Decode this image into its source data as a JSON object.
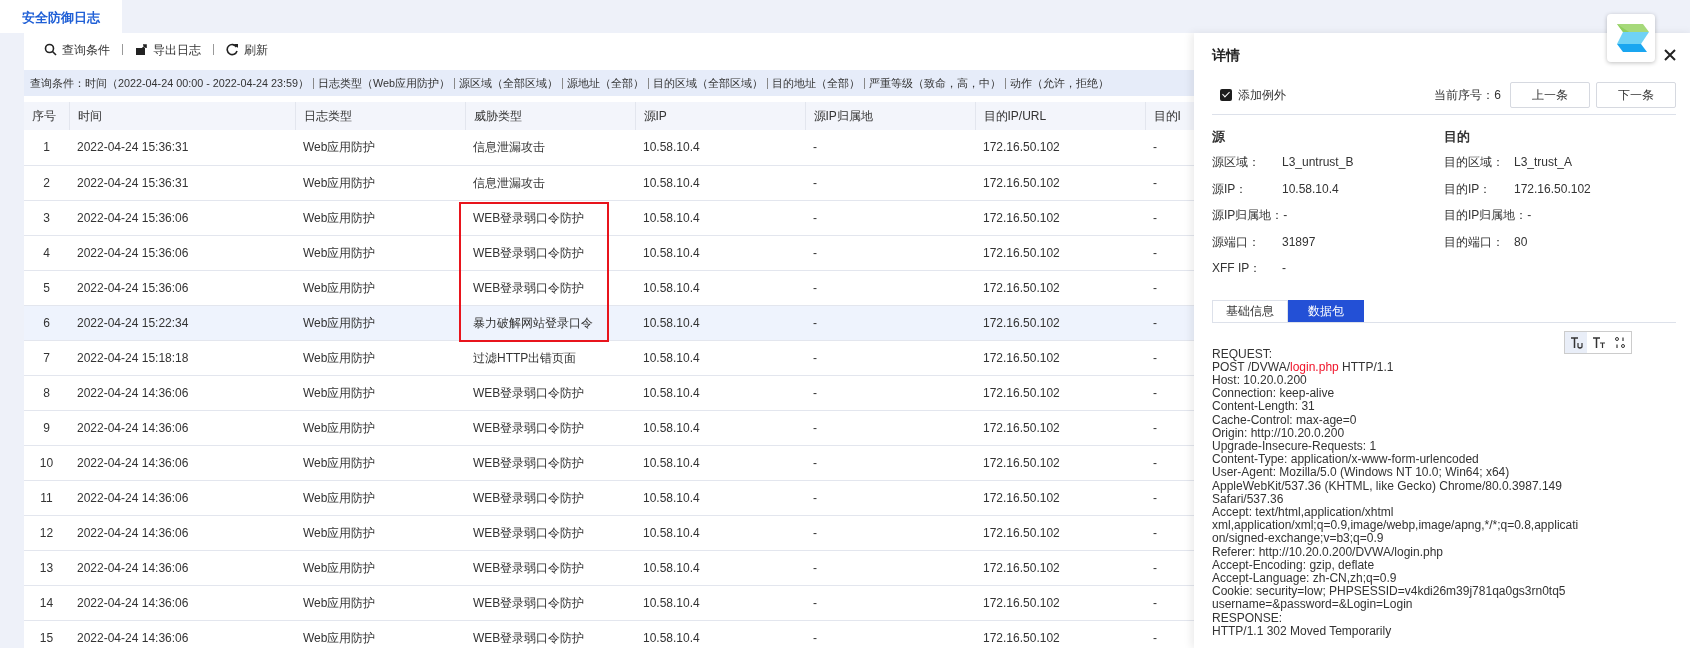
{
  "page_tab": {
    "label": "安全防御日志",
    "selected": true
  },
  "toolbar": [
    {
      "kind": "search",
      "label": "查询条件"
    },
    {
      "kind": "export",
      "label": "导出日志"
    },
    {
      "kind": "refresh",
      "label": "刷新"
    }
  ],
  "filter": {
    "label": "查询条件：",
    "items": [
      "时间（2022-04-24 00:00 - 2022-04-24 23:59）",
      "日志类型（Web应用防护）",
      "源区域（全部区域）",
      "源地址（全部）",
      "目的区域（全部区域）",
      "目的地址（全部）",
      "严重等级（致命，高，中）",
      "动作（允许，拒绝）"
    ]
  },
  "table": {
    "columns": [
      "序号",
      "时间",
      "日志类型",
      "威胁类型",
      "源IP",
      "源IP归属地",
      "目的IP/URL",
      "目的I"
    ],
    "rows": [
      {
        "cells": [
          "1",
          "2022-04-24 15:36:31",
          "Web应用防护",
          "信息泄漏攻击",
          "10.58.10.4",
          "-",
          "172.16.50.102",
          "-"
        ],
        "selected": false,
        "flagged": false
      },
      {
        "cells": [
          "2",
          "2022-04-24 15:36:31",
          "Web应用防护",
          "信息泄漏攻击",
          "10.58.10.4",
          "-",
          "172.16.50.102",
          "-"
        ],
        "selected": false,
        "flagged": false
      },
      {
        "cells": [
          "3",
          "2022-04-24 15:36:06",
          "Web应用防护",
          "WEB登录弱口令防护",
          "10.58.10.4",
          "-",
          "172.16.50.102",
          "-"
        ],
        "selected": false,
        "flagged": true
      },
      {
        "cells": [
          "4",
          "2022-04-24 15:36:06",
          "Web应用防护",
          "WEB登录弱口令防护",
          "10.58.10.4",
          "-",
          "172.16.50.102",
          "-"
        ],
        "selected": false,
        "flagged": true
      },
      {
        "cells": [
          "5",
          "2022-04-24 15:36:06",
          "Web应用防护",
          "WEB登录弱口令防护",
          "10.58.10.4",
          "-",
          "172.16.50.102",
          "-"
        ],
        "selected": false,
        "flagged": true
      },
      {
        "cells": [
          "6",
          "2022-04-24 15:22:34",
          "Web应用防护",
          "暴力破解网站登录口令",
          "10.58.10.4",
          "-",
          "172.16.50.102",
          "-"
        ],
        "selected": true,
        "flagged": true
      },
      {
        "cells": [
          "7",
          "2022-04-24 15:18:18",
          "Web应用防护",
          "过滤HTTP出错页面",
          "10.58.10.4",
          "-",
          "172.16.50.102",
          "-"
        ],
        "selected": false,
        "flagged": false
      },
      {
        "cells": [
          "8",
          "2022-04-24 14:36:06",
          "Web应用防护",
          "WEB登录弱口令防护",
          "10.58.10.4",
          "-",
          "172.16.50.102",
          "-"
        ],
        "selected": false,
        "flagged": false
      },
      {
        "cells": [
          "9",
          "2022-04-24 14:36:06",
          "Web应用防护",
          "WEB登录弱口令防护",
          "10.58.10.4",
          "-",
          "172.16.50.102",
          "-"
        ],
        "selected": false,
        "flagged": false
      },
      {
        "cells": [
          "10",
          "2022-04-24 14:36:06",
          "Web应用防护",
          "WEB登录弱口令防护",
          "10.58.10.4",
          "-",
          "172.16.50.102",
          "-"
        ],
        "selected": false,
        "flagged": false
      },
      {
        "cells": [
          "11",
          "2022-04-24 14:36:06",
          "Web应用防护",
          "WEB登录弱口令防护",
          "10.58.10.4",
          "-",
          "172.16.50.102",
          "-"
        ],
        "selected": false,
        "flagged": false
      },
      {
        "cells": [
          "12",
          "2022-04-24 14:36:06",
          "Web应用防护",
          "WEB登录弱口令防护",
          "10.58.10.4",
          "-",
          "172.16.50.102",
          "-"
        ],
        "selected": false,
        "flagged": false
      },
      {
        "cells": [
          "13",
          "2022-04-24 14:36:06",
          "Web应用防护",
          "WEB登录弱口令防护",
          "10.58.10.4",
          "-",
          "172.16.50.102",
          "-"
        ],
        "selected": false,
        "flagged": false
      },
      {
        "cells": [
          "14",
          "2022-04-24 14:36:06",
          "Web应用防护",
          "WEB登录弱口令防护",
          "10.58.10.4",
          "-",
          "172.16.50.102",
          "-"
        ],
        "selected": false,
        "flagged": false
      },
      {
        "cells": [
          "15",
          "2022-04-24 14:36:06",
          "Web应用防护",
          "WEB登录弱口令防护",
          "10.58.10.4",
          "-",
          "172.16.50.102",
          "-"
        ],
        "selected": false,
        "flagged": false
      }
    ]
  },
  "detail": {
    "title": "详情",
    "add_exception": {
      "label": "添加例外",
      "checked": true
    },
    "current": "当前序号：6",
    "buttons": [
      "上一条",
      "下一条"
    ],
    "source": {
      "heading": "源",
      "fields": [
        {
          "label": "源区域：",
          "value": "L3_untrust_B"
        },
        {
          "label": "源IP：",
          "value": "10.58.10.4"
        },
        {
          "label": "源IP归属地：",
          "value": "-"
        },
        {
          "label": "源端口：",
          "value": "31897"
        },
        {
          "label": "XFF IP：",
          "value": "-"
        }
      ]
    },
    "destination": {
      "heading": "目的",
      "fields": [
        {
          "label": "目的区域：",
          "value": "L3_trust_A"
        },
        {
          "label": "目的IP：",
          "value": "172.16.50.102"
        },
        {
          "label": "目的IP归属地：",
          "value": "-"
        },
        {
          "label": "目的端口：",
          "value": "80"
        }
      ]
    },
    "tabs": [
      {
        "label": "基础信息",
        "selected": false
      },
      {
        "label": "数据包",
        "selected": true
      }
    ],
    "view_tools": [
      {
        "kind": "underline",
        "selected": true
      },
      {
        "kind": "text",
        "selected": false
      },
      {
        "kind": "binary",
        "selected": false
      }
    ],
    "packet_lines": [
      [
        {
          "text": "REQUEST:",
          "highlight": false
        }
      ],
      [
        {
          "text": "POST /DVWA/",
          "highlight": false
        },
        {
          "text": "login.php",
          "highlight": true
        },
        {
          "text": " HTTP/1.1",
          "highlight": false
        }
      ],
      [
        {
          "text": "Host: 10.20.0.200",
          "highlight": false
        }
      ],
      [
        {
          "text": "Connection: keep-alive",
          "highlight": false
        }
      ],
      [
        {
          "text": "Content-Length: 31",
          "highlight": false
        }
      ],
      [
        {
          "text": "Cache-Control: max-age=0",
          "highlight": false
        }
      ],
      [
        {
          "text": "Origin: http://10.20.0.200",
          "highlight": false
        }
      ],
      [
        {
          "text": "Upgrade-Insecure-Requests: 1",
          "highlight": false
        }
      ],
      [
        {
          "text": "Content-Type: application/x-www-form-urlencoded",
          "highlight": false
        }
      ],
      [
        {
          "text": "User-Agent: Mozilla/5.0 (Windows NT 10.0; Win64; x64)",
          "highlight": false
        }
      ],
      [
        {
          "text": "AppleWebKit/537.36 (KHTML, like Gecko) Chrome/80.0.3987.149",
          "highlight": false
        }
      ],
      [
        {
          "text": "Safari/537.36",
          "highlight": false
        }
      ],
      [
        {
          "text": "Accept: text/html,application/xhtml",
          "highlight": false
        }
      ],
      [
        {
          "text": "xml,application/xml;q=0.9,image/webp,image/apng,*/*;q=0.8,applicati",
          "highlight": false
        }
      ],
      [
        {
          "text": "on/signed-exchange;v=b3;q=0.9",
          "highlight": false
        }
      ],
      [
        {
          "text": "Referer: http://10.20.0.200/DVWA/login.php",
          "highlight": false
        }
      ],
      [
        {
          "text": "Accept-Encoding: gzip, deflate",
          "highlight": false
        }
      ],
      [
        {
          "text": "Accept-Language: zh-CN,zh;q=0.9",
          "highlight": false
        }
      ],
      [
        {
          "text": "Cookie: security=low; PHPSESSID=v4kdi26m39j781qa0gs3rn0tq5",
          "highlight": false
        }
      ],
      [
        {
          "text": "username=&password=&Login=Login",
          "highlight": false
        }
      ],
      [
        {
          "text": "RESPONSE:",
          "highlight": false
        }
      ],
      [
        {
          "text": "HTTP/1.1 302 Moved Temporarily",
          "highlight": false
        }
      ]
    ]
  }
}
